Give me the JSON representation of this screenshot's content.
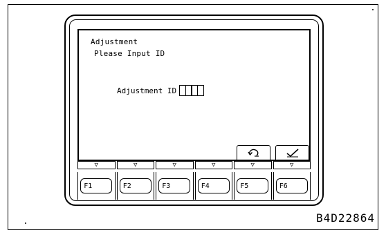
{
  "screen": {
    "title": "Adjustment",
    "prompt": "Please Input ID",
    "id_label": "Adjustment ID",
    "id_digits": [
      "",
      "",
      "",
      ""
    ]
  },
  "softkeys": [
    {
      "icon": "return-icon"
    },
    {
      "icon": "check-icon"
    }
  ],
  "arrows": [
    "▽",
    "▽",
    "▽",
    "▽",
    "▽",
    "▽"
  ],
  "function_keys": [
    {
      "label": "F1"
    },
    {
      "label": "F2"
    },
    {
      "label": "F3"
    },
    {
      "label": "F4"
    },
    {
      "label": "F5"
    },
    {
      "label": "F6"
    }
  ],
  "figure_id": "B4D22864"
}
